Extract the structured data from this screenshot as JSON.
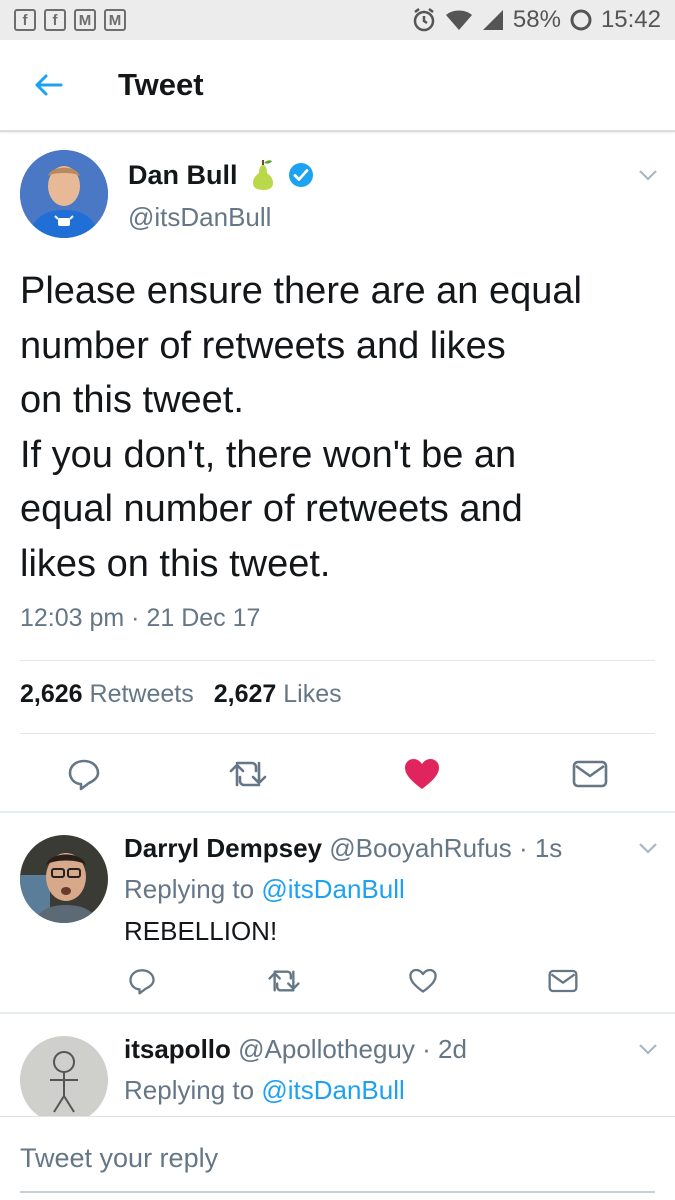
{
  "status_bar": {
    "left_icons": [
      "facebook-icon",
      "facebook-icon",
      "gmail-icon",
      "gmail-icon"
    ],
    "battery": "58%",
    "time": "15:42"
  },
  "header": {
    "title": "Tweet"
  },
  "tweet": {
    "author_name": "Dan Bull",
    "author_handle": "@itsDanBull",
    "text_lines": [
      "Please ensure there are an equal",
      "number of retweets and likes",
      "on this tweet.",
      "If you don't, there won't be an",
      "equal number of retweets and",
      "likes on this tweet."
    ],
    "time": "12:03 pm · 21 Dec 17",
    "retweet_count": "2,626",
    "retweet_label": "Retweets",
    "like_count": "2,627",
    "like_label": "Likes",
    "liked": true
  },
  "replies": [
    {
      "name": "Darryl Dempsey",
      "handle": "@BooyahRufus",
      "age": "· 1s",
      "replying_label": "Replying to",
      "replying_to": "@itsDanBull",
      "text": "REBELLION!"
    },
    {
      "name": "itsapollo",
      "handle": "@Apollotheguy",
      "age": "· 2d",
      "replying_label": "Replying to",
      "replying_to": "@itsDanBull",
      "text": ""
    }
  ],
  "compose": {
    "placeholder": "Tweet your reply"
  },
  "colors": {
    "accent": "#1da1f2",
    "like": "#e0245e",
    "secondary_text": "#657786",
    "verified": "#1da1f2"
  }
}
